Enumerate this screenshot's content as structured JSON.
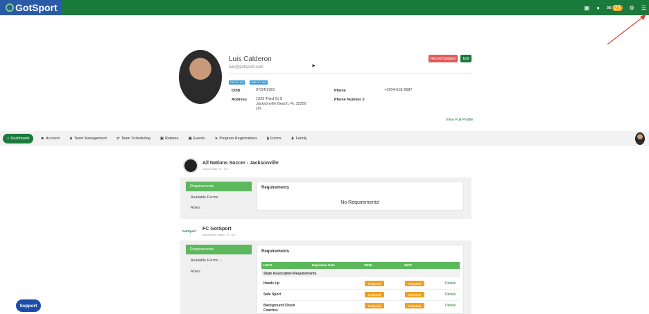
{
  "topbar": {
    "logo": "GotSport",
    "mail_count": "23"
  },
  "profile": {
    "name": "Luis Calderon",
    "email": "luis@gotsport.com",
    "recent_updates": "Recent Updates",
    "edit": "Edit",
    "tags": [
      "FIFA ID: N/A",
      "USSF ID: N/A"
    ],
    "dob_label": "DOB",
    "dob": "07/24/1991",
    "address_label": "Address",
    "address_line1": "1029 Third St S",
    "address_line2": "Jacksonville Beach, FL 32250",
    "address_line3": "US",
    "phone_label": "Phone",
    "phone": "+1904-518-9587",
    "phone2_label": "Phone Number 2",
    "view_full_profile": "View Full Profile"
  },
  "nav": {
    "items": [
      "Dashboard",
      "Account",
      "Team Management",
      "Team Scheduling",
      "Referee",
      "Events",
      "Program Registrations",
      "Forms",
      "Family"
    ]
  },
  "org1": {
    "name": "All Nations Soccer - Jacksonville",
    "location": "Jacksonville, FL, US",
    "sidebar": [
      "Requirements",
      "Available Forms",
      "Roles"
    ],
    "card_title": "Requirements",
    "empty": "No Requirements!"
  },
  "org2": {
    "logo_text": "GotSport",
    "name": "FC GotSport",
    "location": "jacksonville beach, FL, US",
    "sidebar": [
      "Requirements",
      "Available Forms",
      "Roles"
    ],
    "card_title": "Requirements",
    "table_headers": [
      "USYS",
      "Expiration Date",
      "25/26",
      "26/27"
    ],
    "section": "State Association Requirements",
    "rows": [
      {
        "name": "Heads Up",
        "c1": "Required",
        "c2": "Required",
        "link": "Details"
      },
      {
        "name": "Safe Sport",
        "c1": "Required",
        "c2": "Required",
        "link": "Details"
      },
      {
        "name": "Background Check Coaches",
        "c1": "Required",
        "c2": "Required",
        "link": "Details"
      }
    ]
  },
  "support": "Support"
}
